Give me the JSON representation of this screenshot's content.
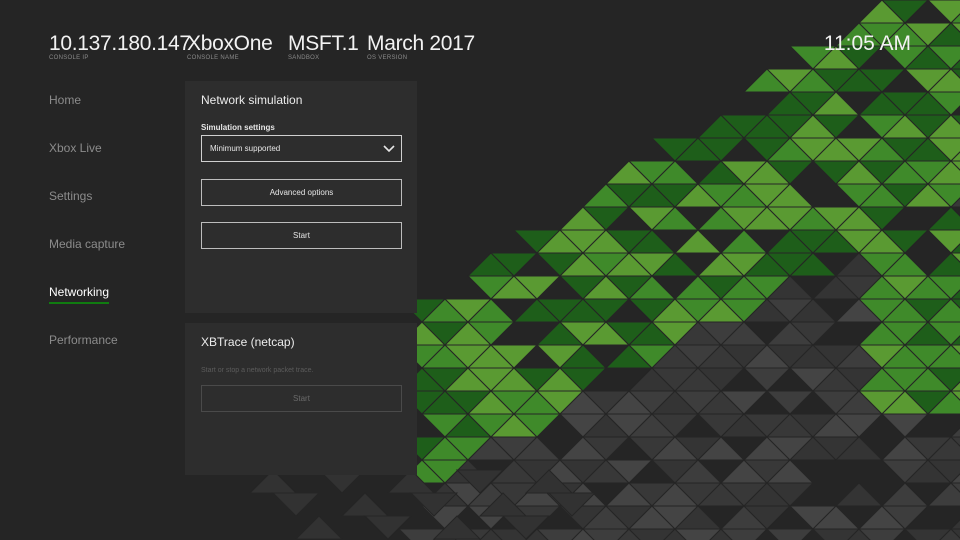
{
  "header": {
    "items": [
      {
        "value": "10.137.180.147",
        "caption": "CONSOLE IP"
      },
      {
        "value": "XboxOne",
        "caption": "CONSOLE NAME"
      },
      {
        "value": "MSFT.1",
        "caption": "SANDBOX"
      },
      {
        "value": "March 2017",
        "caption": "OS VERSION"
      }
    ],
    "time": "11:05 AM"
  },
  "nav": {
    "items": [
      {
        "label": "Home"
      },
      {
        "label": "Xbox Live"
      },
      {
        "label": "Settings"
      },
      {
        "label": "Media capture"
      },
      {
        "label": "Networking",
        "active": true
      },
      {
        "label": "Performance"
      }
    ]
  },
  "network_simulation": {
    "title": "Network simulation",
    "settings_label": "Simulation settings",
    "selected_option": "Minimum supported",
    "advanced_label": "Advanced options",
    "start_label": "Start"
  },
  "xbtrace": {
    "title": "XBTrace (netcap)",
    "description": "Start or stop a network packet trace.",
    "start_label": "Start"
  },
  "colors": {
    "background": "#252525",
    "panel": "#2d2d2d",
    "accent": "#107c10",
    "green_light": "#5a9a32",
    "green_mid": "#3f8a2a",
    "green_dark": "#1e5e1a",
    "grey_tri": "#3d3d3d"
  }
}
